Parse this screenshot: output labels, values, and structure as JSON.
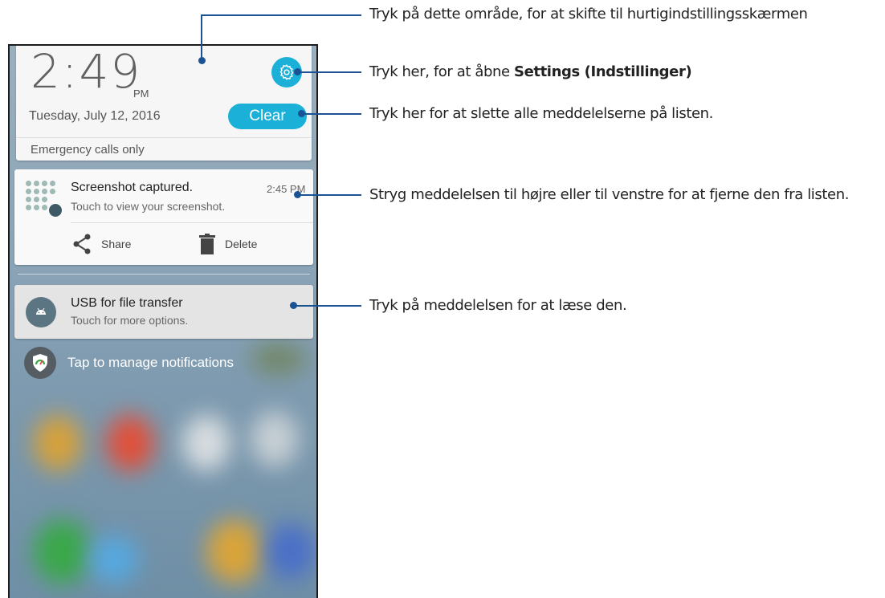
{
  "status": {
    "time": "2:49",
    "ampm": "PM",
    "date": "Tuesday, July 12, 2016",
    "clear_label": "Clear",
    "network": "Emergency calls only"
  },
  "notifications": [
    {
      "title": "Screenshot captured.",
      "time": "2:45 PM",
      "text": "Touch to view your screenshot.",
      "actions": [
        {
          "label": "Share",
          "icon": "share-icon"
        },
        {
          "label": "Delete",
          "icon": "trash-icon"
        }
      ]
    },
    {
      "title": "USB for file transfer",
      "text": "Touch for more options.",
      "icon": "android-icon"
    }
  ],
  "manage_label": "Tap to manage notifications",
  "callouts": {
    "quick_settings": "Tryk på dette område, for at skifte til hurtigindstillingsskærmen",
    "settings_prefix": "Tryk her, for at åbne ",
    "settings_bold": "Settings (Indstillinger)",
    "clear": "Tryk her for at slette alle meddelelserne på listen.",
    "swipe": "Stryg meddelelsen til højre eller til venstre for at fjerne den fra listen.",
    "read": "Tryk på meddelelsen for at læse den."
  },
  "colors": {
    "accent": "#1ab0d8",
    "callout_line": "#1a5294"
  }
}
